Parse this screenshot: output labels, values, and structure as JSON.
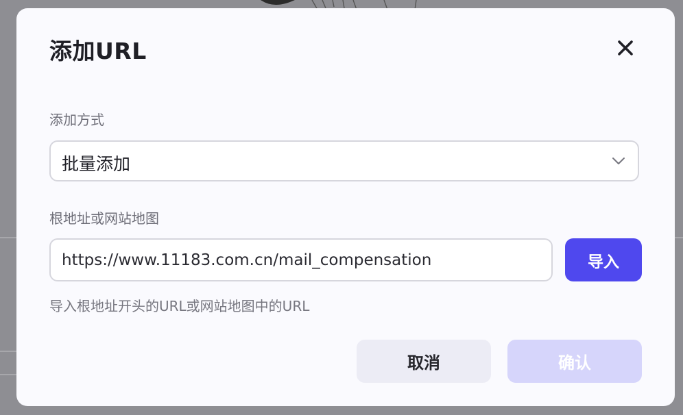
{
  "dialog": {
    "title": "添加URL",
    "close_icon": "close-icon"
  },
  "add_method": {
    "label": "添加方式",
    "selected": "批量添加",
    "chevron_icon": "chevron-down-icon"
  },
  "url_source": {
    "label": "根地址或网站地图",
    "value": "https://www.11183.com.cn/mail_compensation",
    "import_label": "导入",
    "hint": "导入根地址开头的URL或网站地图中的URL"
  },
  "footer": {
    "cancel_label": "取消",
    "confirm_label": "确认"
  },
  "colors": {
    "accent": "#4f48ee",
    "accent_disabled": "#d6d5fb",
    "overlay": "#8e8e93"
  }
}
